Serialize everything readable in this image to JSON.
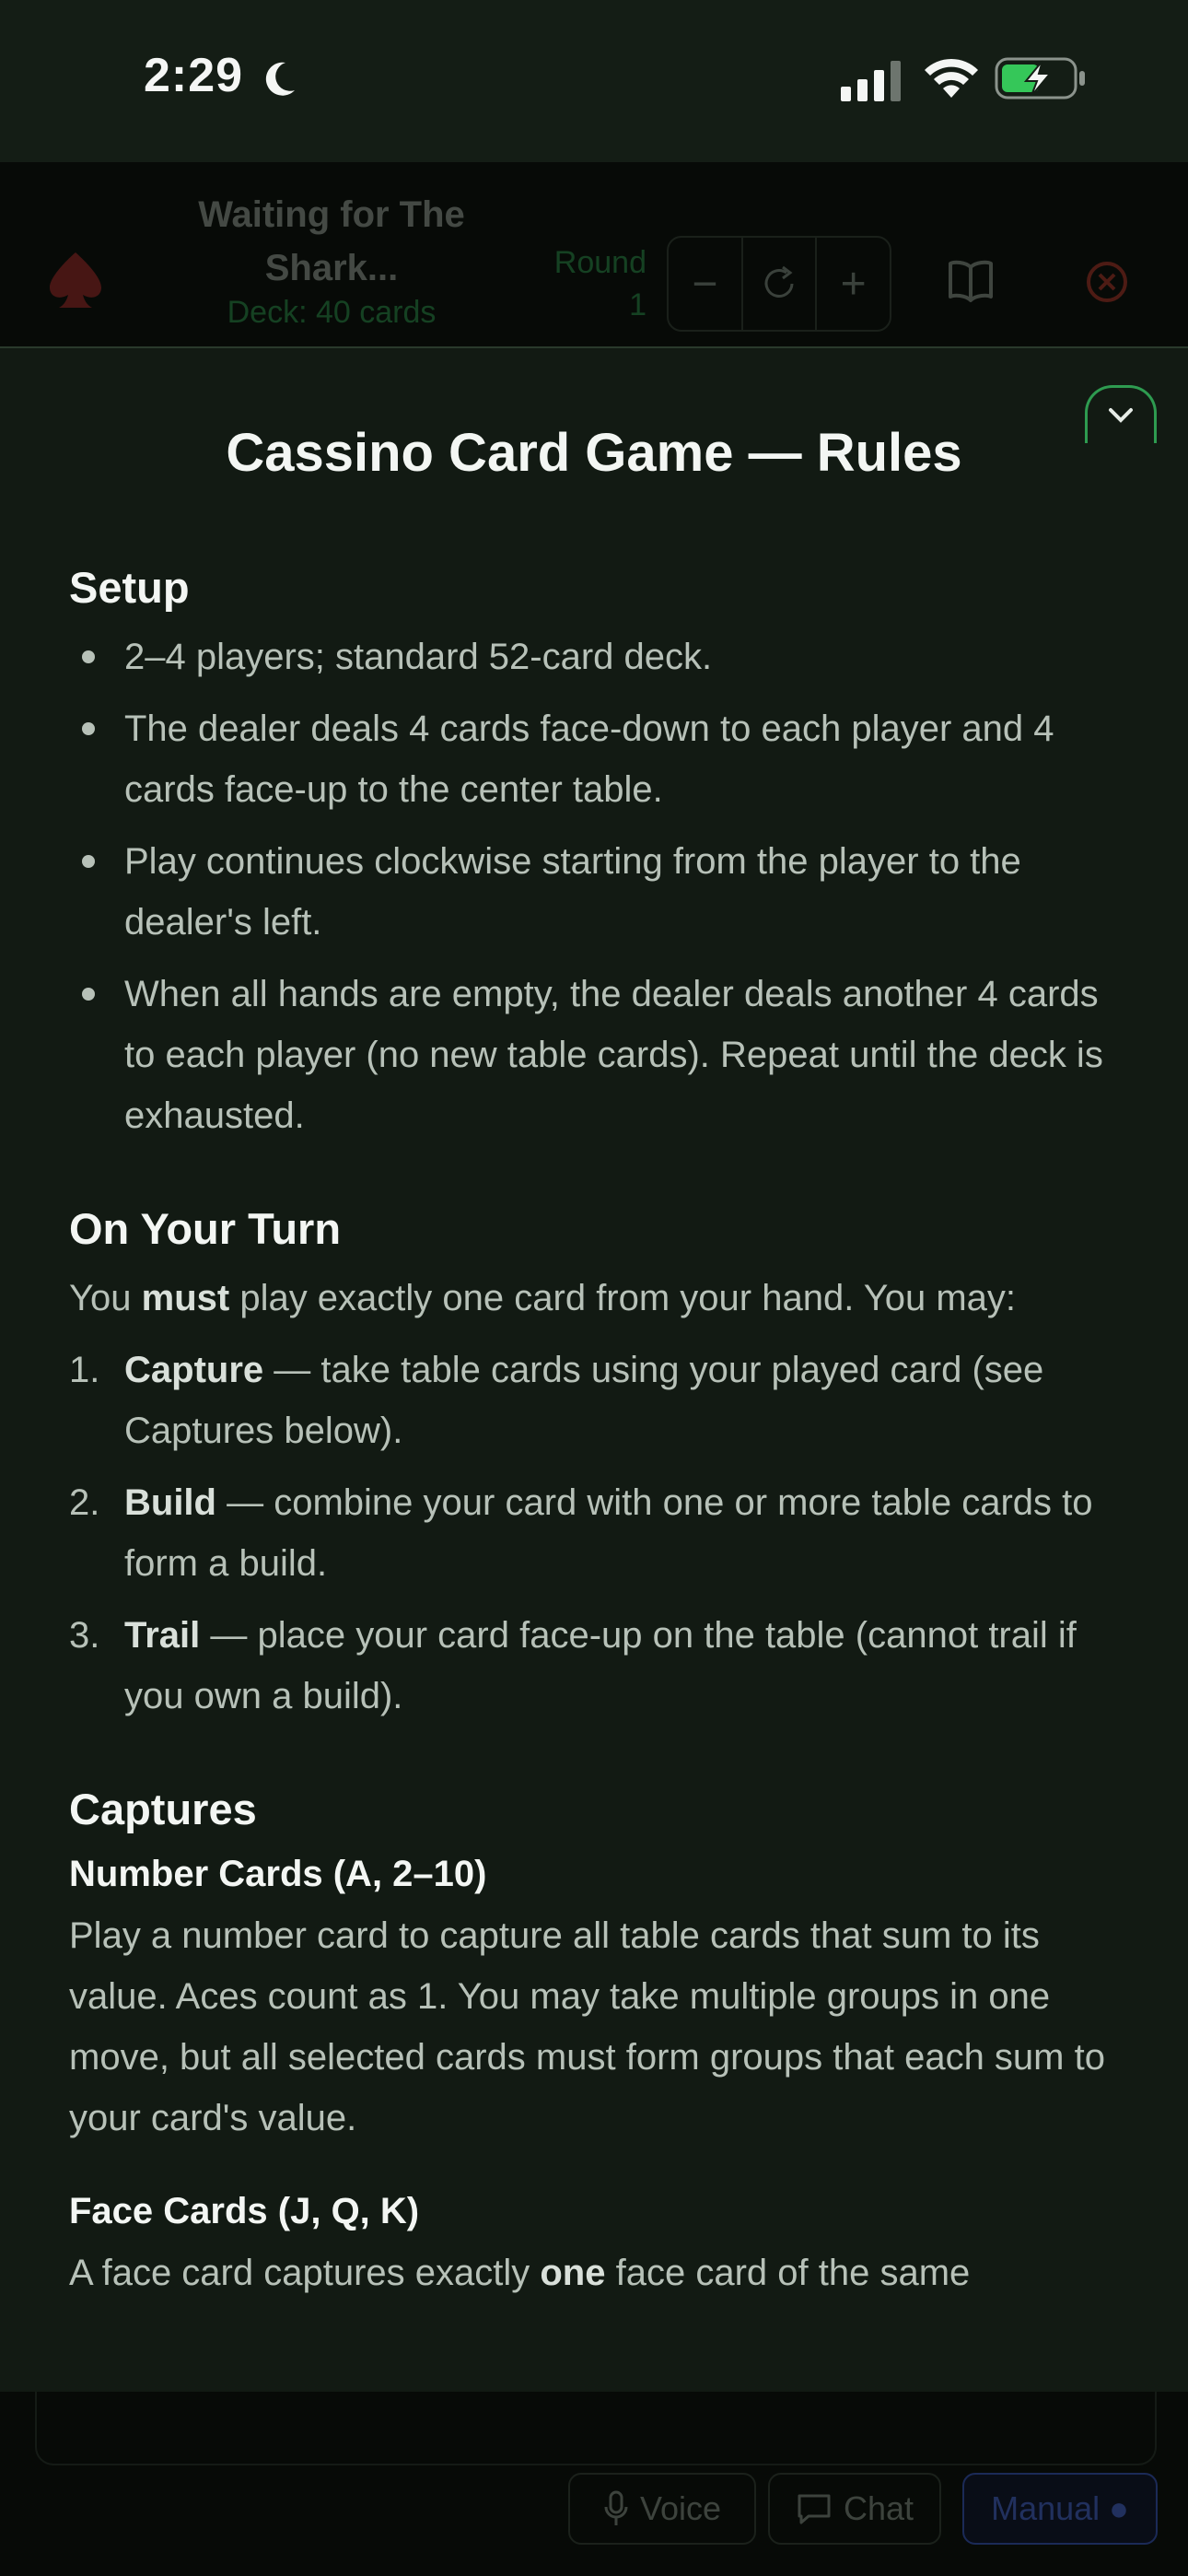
{
  "status_bar": {
    "time": "2:29"
  },
  "game_header": {
    "waiting_text": "Waiting for The Shark...",
    "deck_text": "Deck: 40 cards",
    "round_label": "Round",
    "round_value": "1",
    "stepper_minus": "−",
    "stepper_plus": "+"
  },
  "rules": {
    "title": "Cassino Card Game — Rules",
    "setup": {
      "heading": "Setup",
      "items": [
        "2–4 players; standard 52-card deck.",
        "The dealer deals 4 cards face-down to each player and 4 cards face-up to the center table.",
        "Play continues clockwise starting from the player to the dealer's left.",
        "When all hands are empty, the dealer deals another 4 cards to each player (no new table cards). Repeat until the deck is exhausted."
      ]
    },
    "turn": {
      "heading": "On Your Turn",
      "intro_pre": "You ",
      "intro_bold": "must",
      "intro_post": " play exactly one card from your hand. You may:",
      "items": [
        {
          "num": "1.",
          "bold": "Capture",
          "text": " — take table cards using your played card (see Captures below)."
        },
        {
          "num": "2.",
          "bold": "Build",
          "text": " — combine your card with one or more table cards to form a build."
        },
        {
          "num": "3.",
          "bold": "Trail",
          "text": " — place your card face-up on the table (cannot trail if you own a build)."
        }
      ]
    },
    "captures": {
      "heading": "Captures",
      "number_heading": "Number Cards (A, 2–10)",
      "number_text": "Play a number card to capture all table cards that sum to its value. Aces count as 1. You may take multiple groups in one move, but all selected cards must form groups that each sum to your card's value.",
      "face_heading": "Face Cards (J, Q, K)",
      "face_pre": "A face card captures exactly ",
      "face_bold": "one",
      "face_post": " face card of the same"
    }
  },
  "bottom_bar": {
    "voice_label": "Voice",
    "chat_label": "Chat",
    "manual_label": "Manual ●"
  },
  "colors": {
    "accent_green": "#2e9b50",
    "manual_blue": "#4a6ae0",
    "background": "#121a13"
  }
}
